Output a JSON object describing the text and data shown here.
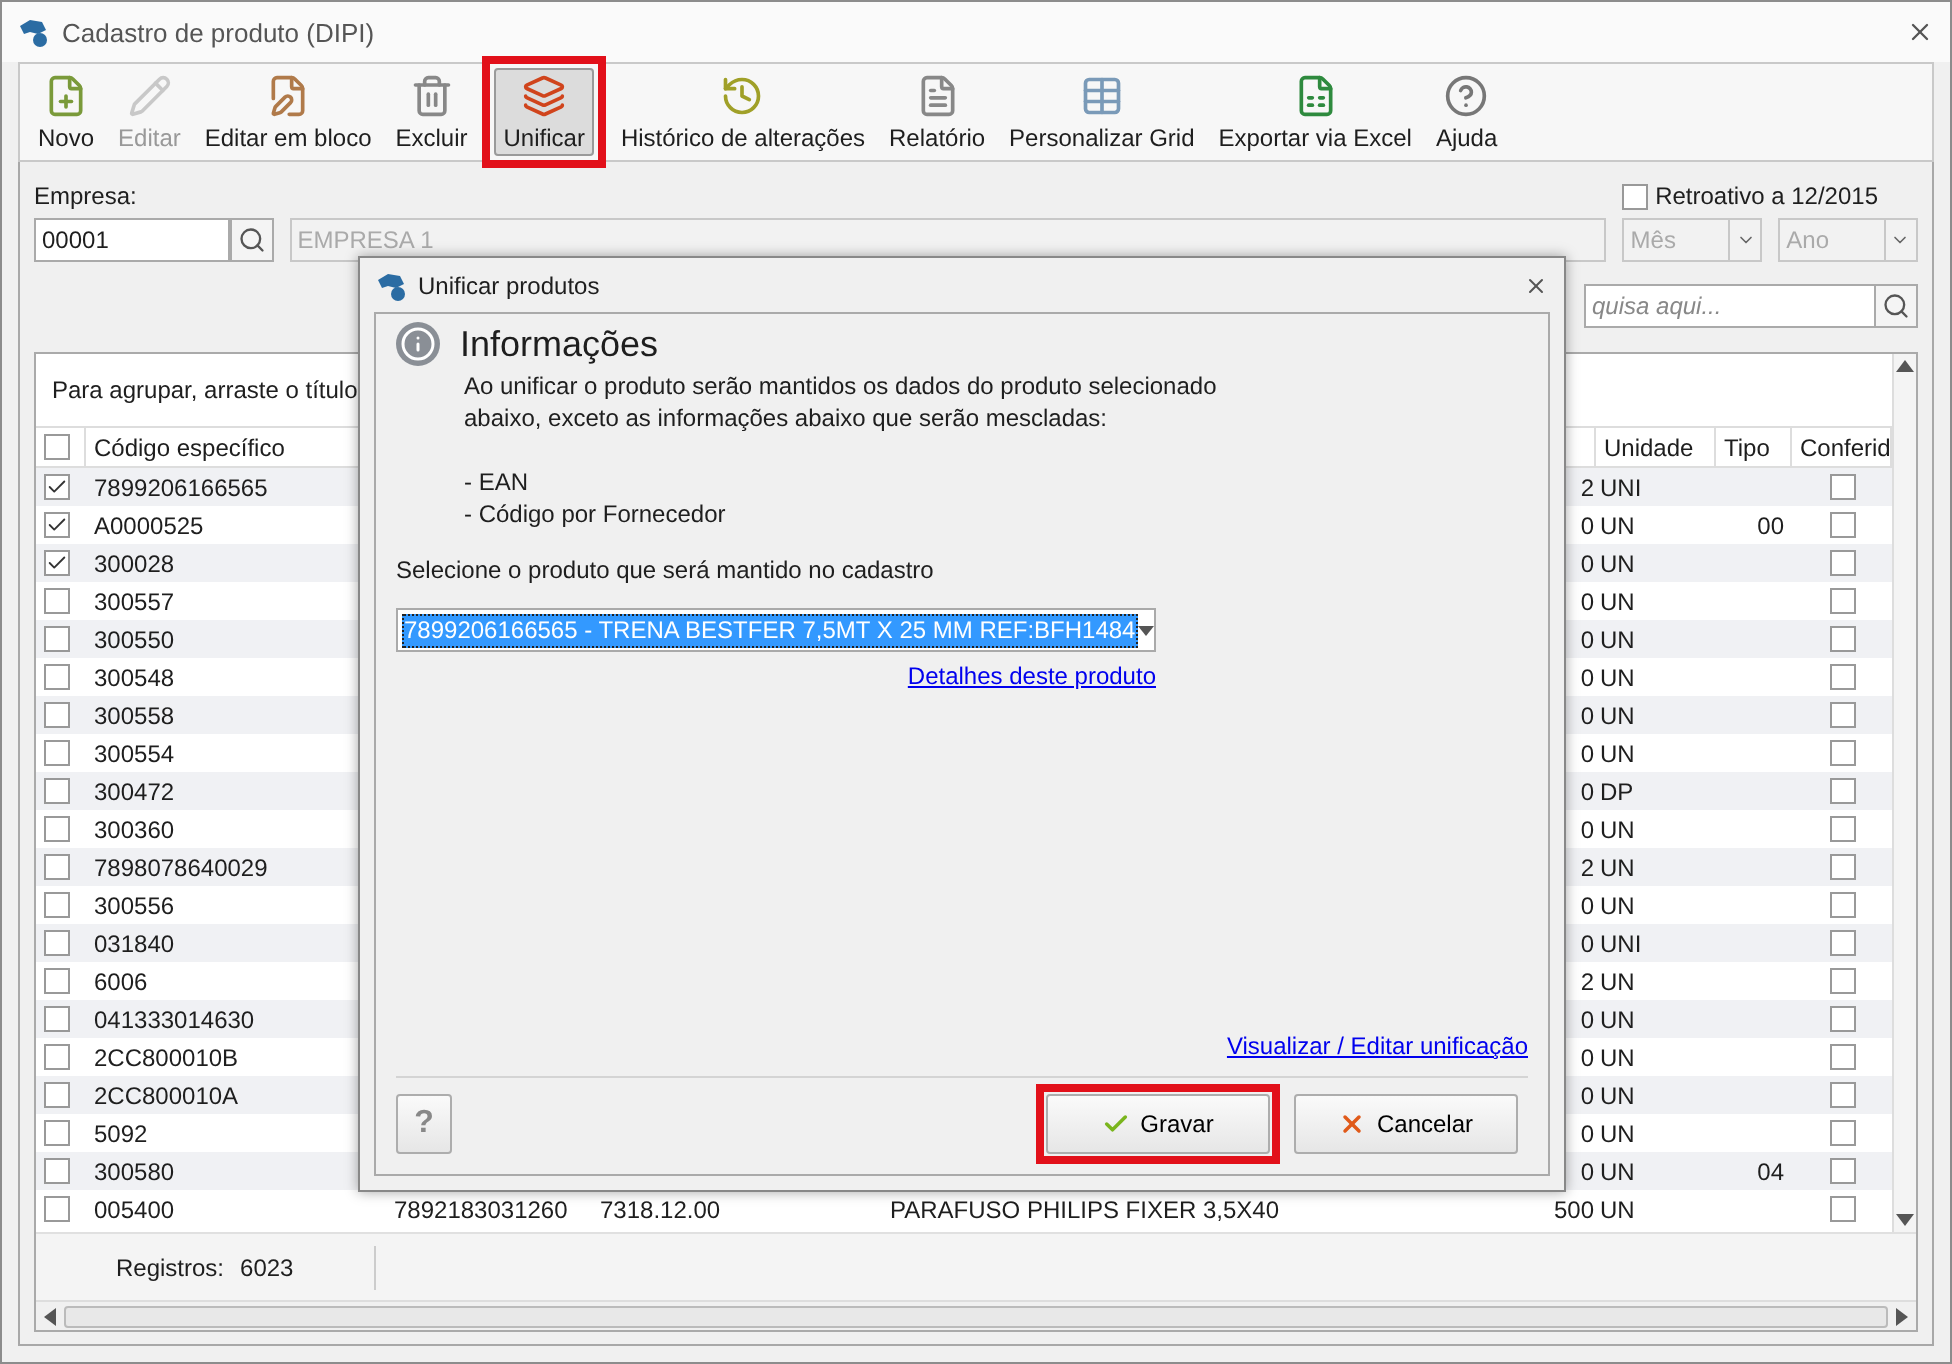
{
  "window": {
    "title": "Cadastro de produto (DIPI)"
  },
  "toolbar": {
    "items": [
      {
        "label": "Novo",
        "disabled": false,
        "selected": false,
        "highlighted": false
      },
      {
        "label": "Editar",
        "disabled": true,
        "selected": false,
        "highlighted": false
      },
      {
        "label": "Editar em bloco",
        "disabled": false,
        "selected": false,
        "highlighted": false
      },
      {
        "label": "Excluir",
        "disabled": false,
        "selected": false,
        "highlighted": false
      },
      {
        "label": "Unificar",
        "disabled": false,
        "selected": true,
        "highlighted": true
      },
      {
        "label": "Histórico de alterações",
        "disabled": false,
        "selected": false,
        "highlighted": false
      },
      {
        "label": "Relatório",
        "disabled": false,
        "selected": false,
        "highlighted": false
      },
      {
        "label": "Personalizar Grid",
        "disabled": false,
        "selected": false,
        "highlighted": false
      },
      {
        "label": "Exportar via Excel",
        "disabled": false,
        "selected": false,
        "highlighted": false
      },
      {
        "label": "Ajuda",
        "disabled": false,
        "selected": false,
        "highlighted": false
      }
    ]
  },
  "filters": {
    "empresa_label": "Empresa:",
    "empresa_code": "00001",
    "empresa_name": "EMPRESA 1",
    "retroativo": {
      "label": "Retroativo a 12/2015",
      "checked": false
    },
    "month": "Mês",
    "year": "Ano",
    "search_placeholder": "quisa aqui..."
  },
  "grid": {
    "group_hint": "Para agrupar, arraste o título",
    "columns": [
      "Código específico",
      "Unidade",
      "Tipo",
      "Conferid"
    ],
    "select_all": false,
    "rows": [
      {
        "checked": true,
        "code": "7899206166565",
        "qty": "2",
        "unit": "UNI",
        "conferido": false
      },
      {
        "checked": true,
        "code": "A0000525",
        "qty": "0",
        "unit": "UN",
        "tipo": "00",
        "conferido": false
      },
      {
        "checked": true,
        "code": "300028",
        "qty": "0",
        "unit": "UN",
        "conferido": false
      },
      {
        "checked": false,
        "code": "300557",
        "qty": "0",
        "unit": "UN",
        "conferido": false
      },
      {
        "checked": false,
        "code": "300550",
        "qty": "0",
        "unit": "UN",
        "conferido": false
      },
      {
        "checked": false,
        "code": "300548",
        "qty": "0",
        "unit": "UN",
        "conferido": false
      },
      {
        "checked": false,
        "code": "300558",
        "qty": "0",
        "unit": "UN",
        "conferido": false
      },
      {
        "checked": false,
        "code": "300554",
        "qty": "0",
        "unit": "UN",
        "conferido": false
      },
      {
        "checked": false,
        "code": "300472",
        "qty": "0",
        "unit": "DP",
        "conferido": false
      },
      {
        "checked": false,
        "code": "300360",
        "qty": "0",
        "unit": "UN",
        "conferido": false
      },
      {
        "checked": false,
        "code": "7898078640029",
        "qty": "2",
        "unit": "UN",
        "conferido": false
      },
      {
        "checked": false,
        "code": "300556",
        "qty": "0",
        "unit": "UN",
        "conferido": false
      },
      {
        "checked": false,
        "code": "031840",
        "qty": "0",
        "unit": "UNI",
        "conferido": false
      },
      {
        "checked": false,
        "code": "6006",
        "qty": "2",
        "unit": "UN",
        "conferido": false
      },
      {
        "checked": false,
        "code": "041333014630",
        "qty": "0",
        "unit": "UN",
        "conferido": false
      },
      {
        "checked": false,
        "code": "2CC800010B",
        "qty": "0",
        "unit": "UN",
        "conferido": false
      },
      {
        "checked": false,
        "code": "2CC800010A",
        "qty": "0",
        "unit": "UN",
        "conferido": false
      },
      {
        "checked": false,
        "code": "5092",
        "qty": "0",
        "unit": "UN",
        "conferido": false
      },
      {
        "checked": false,
        "code": "300580",
        "qty": "0",
        "unit": "UN",
        "tipo": "04",
        "conferido": false
      },
      {
        "checked": false,
        "code": "005400",
        "column_2": "7892183031260",
        "column_3": "7318.12.00",
        "column_4": "PARAFUSO PHILIPS FIXER 3,5X40",
        "qty": "500",
        "unit": "UN",
        "conferido": false
      }
    ],
    "footer": {
      "label": "Registros:",
      "count": "6023"
    }
  },
  "dialog": {
    "title": "Unificar produtos",
    "heading": "Informações",
    "message": [
      "Ao unificar o produto serão mantidos os dados do produto selecionado",
      "abaixo, exceto as informações abaixo que serão mescladas:"
    ],
    "merged_fields": [
      "- EAN",
      "- Código por Fornecedor"
    ],
    "select_label": "Selecione o produto que será mantido no cadastro",
    "select_value": "7899206166565 - TRENA BESTFER 7,5MT X 25 MM  REF:BFH1484",
    "details_link": "Detalhes deste produto",
    "edit_link": "Visualizar / Editar unificação",
    "help_button": "?",
    "buttons": [
      {
        "label": "Gravar",
        "kind": "save",
        "highlighted": true
      },
      {
        "label": "Cancelar",
        "kind": "cancel",
        "highlighted": false
      }
    ]
  }
}
